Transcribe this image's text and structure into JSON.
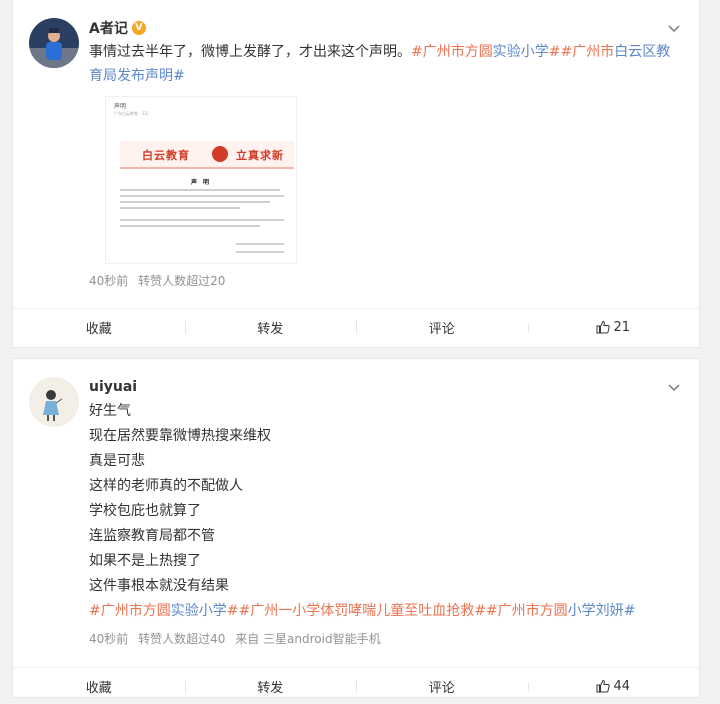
{
  "posts": [
    {
      "author": "A者记",
      "verified_badge": "V",
      "text_parts": [
        {
          "t": "事情过去半年了，微博上发酵了，才出来这个声明。",
          "c": "plain"
        },
        {
          "t": "#广州市方圆",
          "c": "topic"
        },
        {
          "t": "实验小学",
          "c": "topic-b"
        },
        {
          "t": "##广州市",
          "c": "topic"
        },
        {
          "t": "白云区",
          "c": "topic-b"
        },
        {
          "t": "教育局发布声明#",
          "c": "topic-b"
        }
      ],
      "image": {
        "title": "声明",
        "sub": "广东白云教育 · 1天",
        "banner_left": "白云教育",
        "banner_right": "立真求新",
        "heading": "声 明"
      },
      "meta": {
        "time": "40秒前",
        "forward": "转赞人数超过20",
        "source": ""
      },
      "actions": {
        "collect": "收藏",
        "forward": "转发",
        "comment": "评论",
        "like_count": "21"
      }
    },
    {
      "author": "uiyuai",
      "lines": [
        "好生气",
        "现在居然要靠微博热搜来维权",
        "真是可悲",
        "这样的老师真的不配做人",
        "学校包庇也就算了",
        "连监察教育局都不管",
        "如果不是上热搜了",
        "这件事根本就没有结果"
      ],
      "tags": [
        {
          "t": "#广州市方圆",
          "c": "topic"
        },
        {
          "t": "实验小学",
          "c": "topic-b"
        },
        {
          "t": "##广州一小学体罚哮喘儿童至吐血抢救##广州市方圆",
          "c": "topic"
        },
        {
          "t": "小学刘妍#",
          "c": "topic-b"
        }
      ],
      "meta": {
        "time": "40秒前",
        "forward": "转赞人数超过40",
        "source": "来自 三星android智能手机"
      },
      "actions": {
        "collect": "收藏",
        "forward": "转发",
        "comment": "评论",
        "like_count": "44"
      }
    }
  ],
  "colors": {
    "topic_orange": "#eb7350",
    "topic_blue": "#5d87c9",
    "badge": "#f5a623"
  },
  "icons": [
    "chevron-down-icon",
    "thumb-up-icon",
    "verified-icon"
  ]
}
